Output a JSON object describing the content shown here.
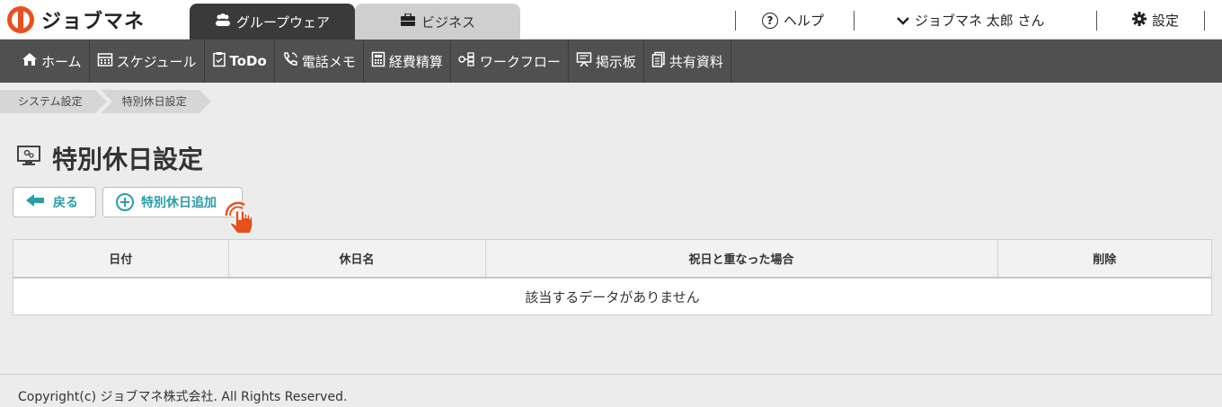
{
  "header": {
    "logo_text": "ジョブマネ",
    "tabs": [
      {
        "label": "グループウェア",
        "icon": "users-icon",
        "active": true
      },
      {
        "label": "ビジネス",
        "icon": "briefcase-icon",
        "active": false
      }
    ],
    "help_label": "ヘルプ",
    "user_label": "ジョブマネ 太郎 さん",
    "settings_label": "設定"
  },
  "nav": {
    "items": [
      {
        "label": "ホーム",
        "icon": "home-icon"
      },
      {
        "label": "スケジュール",
        "icon": "calendar-icon"
      },
      {
        "label": "ToDo",
        "icon": "clipboard-icon"
      },
      {
        "label": "電話メモ",
        "icon": "phone-icon"
      },
      {
        "label": "経費精算",
        "icon": "calculator-icon"
      },
      {
        "label": "ワークフロー",
        "icon": "workflow-icon"
      },
      {
        "label": "掲示板",
        "icon": "board-icon"
      },
      {
        "label": "共有資料",
        "icon": "documents-icon"
      }
    ]
  },
  "breadcrumb": [
    "システム設定",
    "特別休日設定"
  ],
  "page": {
    "title": "特別休日設定",
    "back_label": "戻る",
    "add_label": "特別休日追加"
  },
  "table": {
    "headers": [
      "日付",
      "休日名",
      "祝日と重なった場合",
      "削除"
    ],
    "empty_message": "該当するデータがありません"
  },
  "footer": {
    "copyright": "Copyright(c) ジョブマネ株式会社. All Rights Reserved."
  },
  "colors": {
    "accent": "#2a9da7",
    "brand": "#e8501d",
    "nav_bg": "#505050",
    "tab_active_bg": "#3a3a3a"
  }
}
